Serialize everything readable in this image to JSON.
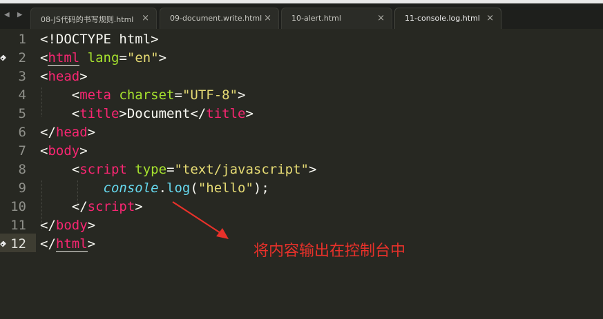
{
  "tabs": [
    {
      "label": "08-JS代码的书写规则.html",
      "active": false
    },
    {
      "label": "09-document.write.html",
      "active": false
    },
    {
      "label": "10-alert.html",
      "active": false
    },
    {
      "label": "11-console.log.html",
      "active": true
    }
  ],
  "nav": {
    "arrows": "◀ ▶"
  },
  "close_glyph": "×",
  "editor": {
    "current_line": 12,
    "bookmarked_lines": [
      2,
      12
    ],
    "lines": [
      {
        "n": "1",
        "tokens": [
          {
            "t": "<!DOCTYPE html>",
            "c": "plain"
          }
        ]
      },
      {
        "n": "2",
        "tokens": [
          {
            "t": "<",
            "c": "plain"
          },
          {
            "t": "html",
            "c": "tag",
            "u": true
          },
          {
            "t": " ",
            "c": "plain"
          },
          {
            "t": "lang",
            "c": "attr"
          },
          {
            "t": "=",
            "c": "plain"
          },
          {
            "t": "\"en\"",
            "c": "str"
          },
          {
            "t": ">",
            "c": "plain"
          }
        ]
      },
      {
        "n": "3",
        "tokens": [
          {
            "t": "<",
            "c": "plain"
          },
          {
            "t": "head",
            "c": "tag"
          },
          {
            "t": ">",
            "c": "plain"
          }
        ]
      },
      {
        "n": "4",
        "tokens": [
          {
            "t": "    <",
            "c": "plain"
          },
          {
            "t": "meta",
            "c": "tag"
          },
          {
            "t": " ",
            "c": "plain"
          },
          {
            "t": "charset",
            "c": "attr"
          },
          {
            "t": "=",
            "c": "plain"
          },
          {
            "t": "\"UTF-8\"",
            "c": "str"
          },
          {
            "t": ">",
            "c": "plain"
          }
        ]
      },
      {
        "n": "5",
        "tokens": [
          {
            "t": "    <",
            "c": "plain"
          },
          {
            "t": "title",
            "c": "tag"
          },
          {
            "t": ">Document</",
            "c": "plain"
          },
          {
            "t": "title",
            "c": "tag"
          },
          {
            "t": ">",
            "c": "plain"
          }
        ]
      },
      {
        "n": "6",
        "tokens": [
          {
            "t": "</",
            "c": "plain"
          },
          {
            "t": "head",
            "c": "tag"
          },
          {
            "t": ">",
            "c": "plain"
          }
        ]
      },
      {
        "n": "7",
        "tokens": [
          {
            "t": "<",
            "c": "plain"
          },
          {
            "t": "body",
            "c": "tag"
          },
          {
            "t": ">",
            "c": "plain"
          }
        ]
      },
      {
        "n": "8",
        "tokens": [
          {
            "t": "    <",
            "c": "plain"
          },
          {
            "t": "script",
            "c": "tag"
          },
          {
            "t": " ",
            "c": "plain"
          },
          {
            "t": "type",
            "c": "attr"
          },
          {
            "t": "=",
            "c": "plain"
          },
          {
            "t": "\"text/javascript\"",
            "c": "str"
          },
          {
            "t": ">",
            "c": "plain"
          }
        ]
      },
      {
        "n": "9",
        "tokens": [
          {
            "t": "        ",
            "c": "plain"
          },
          {
            "t": "console",
            "c": "support"
          },
          {
            "t": ".",
            "c": "plain"
          },
          {
            "t": "log",
            "c": "func"
          },
          {
            "t": "(",
            "c": "plain"
          },
          {
            "t": "\"hello\"",
            "c": "str"
          },
          {
            "t": ");",
            "c": "plain"
          }
        ]
      },
      {
        "n": "10",
        "tokens": [
          {
            "t": "    </",
            "c": "plain"
          },
          {
            "t": "script",
            "c": "tag"
          },
          {
            "t": ">",
            "c": "plain"
          }
        ]
      },
      {
        "n": "11",
        "tokens": [
          {
            "t": "</",
            "c": "plain"
          },
          {
            "t": "body",
            "c": "tag"
          },
          {
            "t": ">",
            "c": "plain"
          }
        ]
      },
      {
        "n": "12",
        "tokens": [
          {
            "t": "</",
            "c": "plain"
          },
          {
            "t": "html",
            "c": "tag",
            "u": true
          },
          {
            "t": ">",
            "c": "plain"
          }
        ]
      }
    ]
  },
  "annotation": {
    "text": "将内容输出在控制台中",
    "color": "#e8312a"
  },
  "colors": {
    "background": "#272822",
    "tag": "#f92672",
    "attr": "#a6e22e",
    "string": "#e6db74",
    "support": "#66d9ef"
  }
}
